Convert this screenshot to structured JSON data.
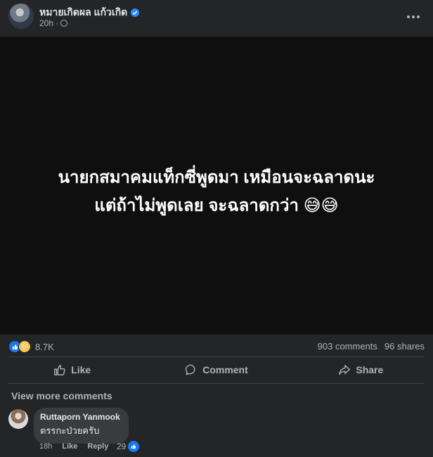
{
  "post": {
    "author": "หมายเกิดผล แก้วเกิด",
    "time": "20h",
    "text_line1": "นายกสมาคมแท็กซี่พูดมา เหมือนจะฉลาดนะ",
    "text_line2": "แต่ถ้าไม่พูดเลย จะฉลาดกว่า 😅😅"
  },
  "stats": {
    "reactions": "8.7K",
    "comments": "903 comments",
    "shares": "96 shares"
  },
  "actions": {
    "like": "Like",
    "comment": "Comment",
    "share": "Share"
  },
  "comments": {
    "view_more": "View more comments",
    "items": [
      {
        "name": "Ruttaporn Yanmook",
        "text": "ตรรกะป่วยครับ",
        "time": "18h",
        "like_label": "Like",
        "reply_label": "Reply",
        "likes": "29"
      }
    ]
  },
  "colors": {
    "background": "#242526",
    "image_bg": "#0f0f10",
    "accent": "#1877f2"
  },
  "icons": [
    "verified-badge-icon",
    "globe-icon",
    "more-options-icon",
    "like-icon",
    "comment-icon",
    "share-icon",
    "haha-reaction-icon"
  ]
}
